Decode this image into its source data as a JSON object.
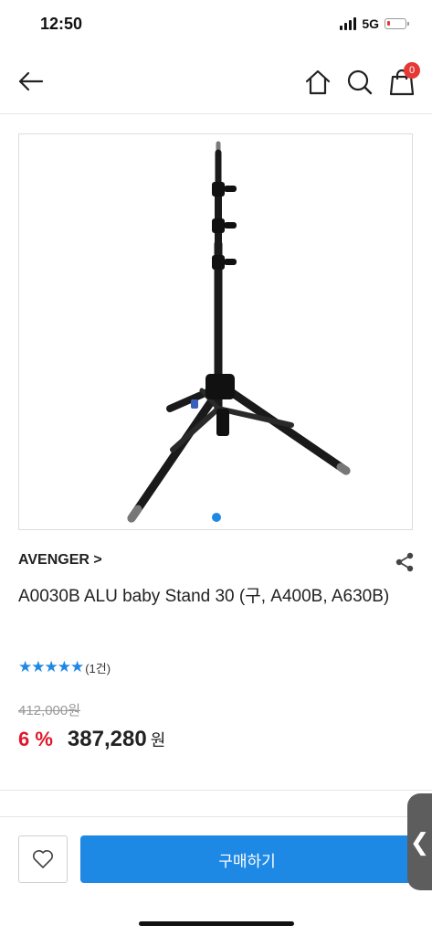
{
  "status_bar": {
    "time": "12:50",
    "network": "5G",
    "battery_color": "#e53935"
  },
  "header": {
    "cart_count": "0",
    "badge_color": "#e53935"
  },
  "product": {
    "brand": "AVENGER >",
    "title": "A0030B ALU baby Stand 30 (구, A400B, A630B)",
    "rating": {
      "stars": "★★★★★",
      "review_count": "(1건)",
      "star_color": "#1e88e5"
    },
    "original_price": "412,000원",
    "discount": "6 %",
    "discount_color": "#e0182d",
    "price": "387,280",
    "currency": "원",
    "image_indicator_active": 1
  },
  "bottom_bar": {
    "buy_label": "구매하기",
    "side_tab_label": "❮",
    "accent": "#1e88e5"
  }
}
